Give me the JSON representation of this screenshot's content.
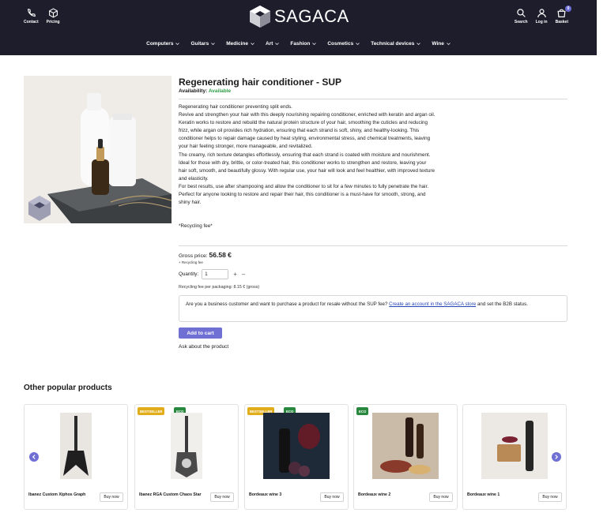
{
  "header": {
    "contact_label": "Contact",
    "pricing_label": "Pricing",
    "brand": "SAGACA",
    "search_label": "Search",
    "login_label": "Log in",
    "basket_label": "Basket",
    "basket_count": "0"
  },
  "nav": [
    "Computers",
    "Guitars",
    "Medicine",
    "Art",
    "Fashion",
    "Cosmetics",
    "Technical devices",
    "Wine"
  ],
  "product": {
    "title": "Regenerating hair conditioner - SUP",
    "availability_label": "Availability:",
    "availability_value": "Available",
    "description": [
      "Regenerating hair conditioner preventing split ends.",
      "Revive and strengthen your hair with this deeply nourishing repairing conditioner, enriched with keratin and argan oil. Keratin works to restore and rebuild the natural protein structure of your hair, smoothing the cuticles and reducing frizz, while argan oil provides rich hydration, ensuring that each strand is soft, shiny, and healthy-looking. This conditioner helps to repair damage caused by heat styling, environmental stress, and chemical treatments, leaving your hair feeling stronger, more manageable, and revitalized.",
      "The creamy, rich texture detangles effortlessly, ensuring that each strand is coated with moisture and nourishment. Ideal for those with dry, brittle, or color-treated hair, this conditioner works to strengthen and restore, leaving your hair soft, smooth, and beautifully glossy. With regular use, your hair will look and feel healthier, with improved texture and elasticity.",
      "For best results, use after shampooing and allow the conditioner to sit for a few minutes to fully penetrate the hair. Perfect for anyone looking to restore and repair their hair, this conditioner is a must-have for smooth, strong, and shiny hair."
    ],
    "recycling_note": "*Recycling fee*",
    "gross_label": "Gross price:",
    "gross_value": "56.58 €",
    "gross_sub": "+ Recycling fee",
    "quantity_label": "Quantity:",
    "quantity_value": "1",
    "fee_line": "Recycling fee per packaging: 8.15 € (gross)",
    "b2b_text_before": "Are you a business customer and want to purchase a product for resale without the SUP fee? ",
    "b2b_link": "Create an account in the SAGACA store",
    "b2b_text_after": " and set the B2B status.",
    "add_to_cart": "Add to cart",
    "ask": "Ask about the product"
  },
  "popular": {
    "title": "Other popular products",
    "buy_label": "Buy now",
    "items": [
      {
        "name": "Ibanez Custom Xiphos Graph",
        "badges": []
      },
      {
        "name": "Ibanez RGA Custom Chaos Star",
        "badges": [
          "BESTSELLER",
          "ECO"
        ]
      },
      {
        "name": "Bordeaux wine 3",
        "badges": [
          "BESTSELLER",
          "ECO"
        ]
      },
      {
        "name": "Bordeaux wine 2",
        "badges": [
          "ECO"
        ]
      },
      {
        "name": "Bordeaux wine 1",
        "badges": []
      }
    ]
  },
  "colors": {
    "header_bg": "#1d1d2c",
    "accent": "#6f6fd4",
    "available": "#2e9e46",
    "bestseller": "#e2ad1a",
    "eco": "#27883e"
  }
}
